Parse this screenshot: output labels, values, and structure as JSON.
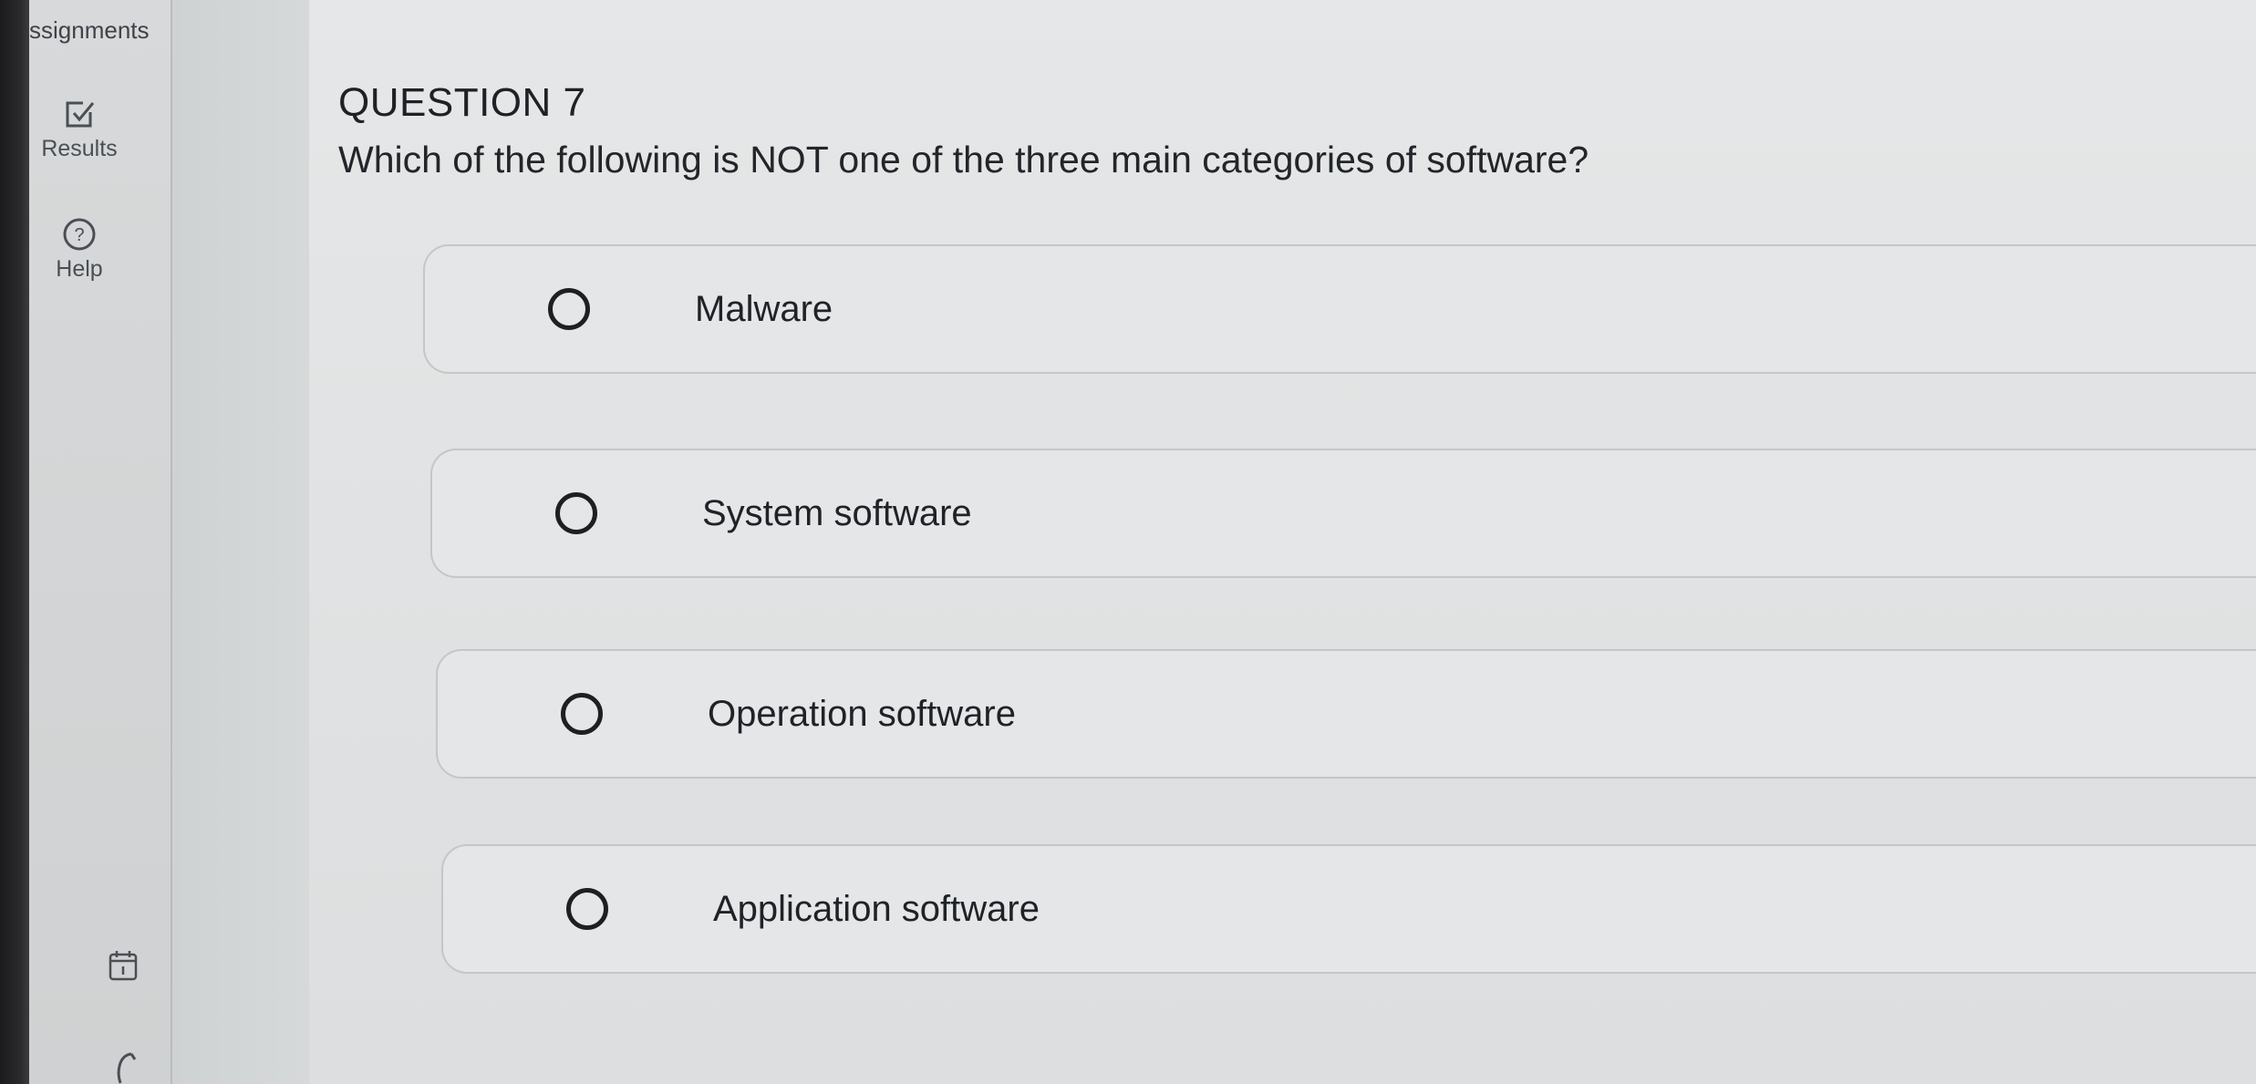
{
  "sidebar": {
    "assignments_label": "ssignments",
    "items": [
      {
        "label": "Results",
        "icon": "checkbox-check-icon"
      },
      {
        "label": "Help",
        "icon": "question-circle-icon"
      }
    ],
    "bottom_icons": [
      "calendar-icon",
      "partial-icon"
    ]
  },
  "question": {
    "number": "QUESTION 7",
    "text": "Which of the following is NOT one of the three main categories of software?",
    "choices": [
      {
        "label": "Malware",
        "selected": false
      },
      {
        "label": "System software",
        "selected": false
      },
      {
        "label": "Operation software",
        "selected": false
      },
      {
        "label": "Application software",
        "selected": false
      }
    ]
  }
}
